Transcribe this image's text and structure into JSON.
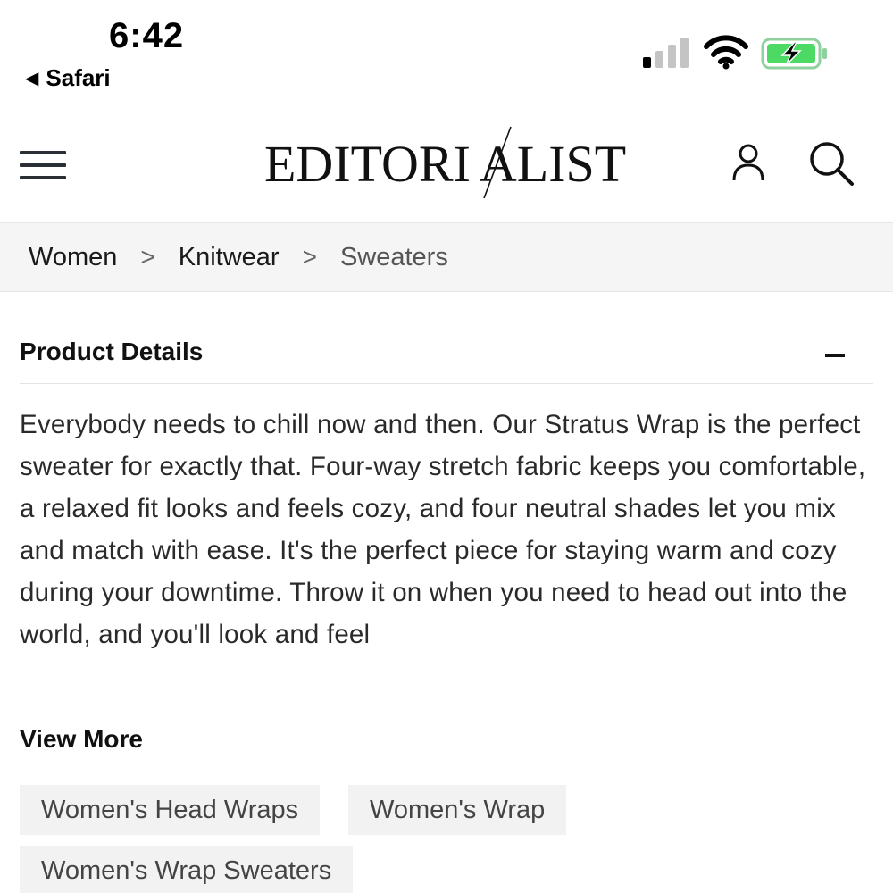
{
  "status_bar": {
    "time": "6:42",
    "back_app": "Safari"
  },
  "header": {
    "logo": "EDITORIALIST",
    "logo_left": "EDITORI",
    "logo_right": "ALIST"
  },
  "breadcrumb": {
    "items": [
      "Women",
      "Knitwear",
      "Sweaters"
    ],
    "separator": ">"
  },
  "product_details": {
    "title": "Product Details",
    "description": "Everybody needs to chill now and then. Our Stratus Wrap is the perfect sweater for exactly that. Four-way stretch fabric keeps you comfortable, a relaxed fit looks and feels cozy, and four neutral shades let you mix and match with ease. It's the perfect piece for staying warm and cozy during your downtime. Throw it on when you need to head out into the world, and you'll look and feel"
  },
  "view_more": {
    "title": "View More",
    "tags": [
      "Women's Head Wraps",
      "Women's Wrap",
      "Women's Wrap Sweaters"
    ]
  },
  "colors": {
    "battery_green": "#4cd964",
    "breadcrumb_bg": "#f5f5f5",
    "tag_bg": "#f2f2f2"
  }
}
